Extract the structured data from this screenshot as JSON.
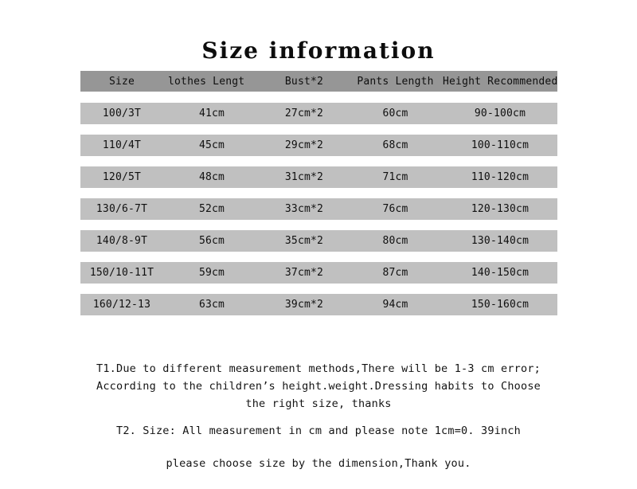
{
  "title": "Size information",
  "table": {
    "columns": [
      "Size",
      "lothes Lengt",
      "Bust*2",
      "Pants Length",
      "Height Recommended"
    ],
    "rows": [
      {
        "size": "100/3T",
        "clothes_length": "41cm",
        "bust": "27cm*2",
        "pants_length": "60cm",
        "height": "90-100cm"
      },
      {
        "size": "110/4T",
        "clothes_length": "45cm",
        "bust": "29cm*2",
        "pants_length": "68cm",
        "height": "100-110cm"
      },
      {
        "size": "120/5T",
        "clothes_length": "48cm",
        "bust": "31cm*2",
        "pants_length": "71cm",
        "height": "110-120cm"
      },
      {
        "size": "130/6-7T",
        "clothes_length": "52cm",
        "bust": "33cm*2",
        "pants_length": "76cm",
        "height": "120-130cm"
      },
      {
        "size": "140/8-9T",
        "clothes_length": "56cm",
        "bust": "35cm*2",
        "pants_length": "80cm",
        "height": "130-140cm"
      },
      {
        "size": "150/10-11T",
        "clothes_length": "59cm",
        "bust": "37cm*2",
        "pants_length": "87cm",
        "height": "140-150cm"
      },
      {
        "size": "160/12-13",
        "clothes_length": "63cm",
        "bust": "39cm*2",
        "pants_length": "94cm",
        "height": "150-160cm"
      }
    ]
  },
  "notes": {
    "t1_line1": "T1.Due to different measurement methods,There will be 1-3 cm error;",
    "t1_line2": "According to the children’s height.weight.Dressing habits to Choose",
    "t1_line3": "the right size, thanks",
    "t2_line1": "T2. Size: All measurement in cm and please note 1cm=0. 39inch",
    "closing": "please choose size by the dimension,Thank you."
  },
  "colors": {
    "header_band": "#969696",
    "data_band": "#c0c0c0",
    "page_background": "#ffffff",
    "text": "#111111"
  }
}
